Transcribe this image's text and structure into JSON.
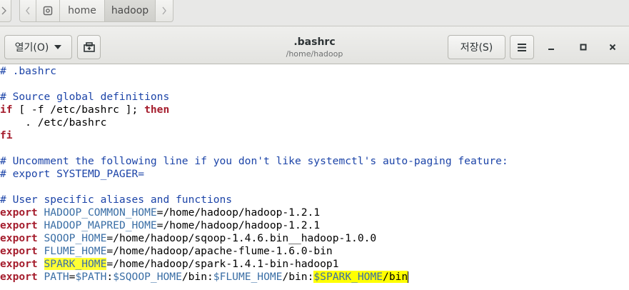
{
  "pathbar": {
    "crumbs": [
      "home",
      "hadoop"
    ]
  },
  "header": {
    "open_label": "열기(O)",
    "title": ".bashrc",
    "subtitle": "/home/hadoop",
    "save_label": "저장(S)"
  },
  "editor": {
    "lines": [
      "# .bashrc",
      "",
      "# Source global definitions",
      "if [ -f /etc/bashrc ]; then",
      "    . /etc/bashrc",
      "fi",
      "",
      "# Uncomment the following line if you don't like systemctl's auto-paging feature:",
      "# export SYSTEMD_PAGER=",
      "",
      "# User specific aliases and functions",
      "export HADOOP_COMMON_HOME=/home/hadoop/hadoop-1.2.1",
      "export HADOOP_MAPRED_HOME=/home/hadoop/hadoop-1.2.1",
      "export SQOOP_HOME=/home/hadoop/sqoop-1.4.6.bin__hadoop-1.0.0",
      "export FLUME_HOME=/home/hadoop/apache-flume-1.6.0-bin",
      "export SPARK_HOME=/home/hadoop/spark-1.4.1-bin-hadoop1",
      "export PATH=$PATH:$SQOOP_HOME/bin:$FLUME_HOME/bin:$SPARK_HOME/bin"
    ],
    "highlight_color": "#ffff33"
  },
  "colors": {
    "comment": "#1c44a8",
    "keyword": "#a51d2d",
    "variable": "#3a6ea5"
  }
}
